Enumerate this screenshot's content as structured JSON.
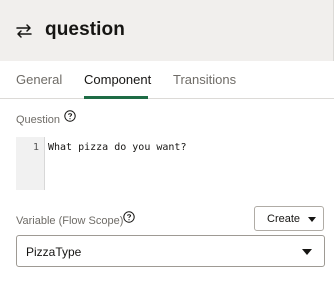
{
  "header": {
    "icon": "swap-arrows-icon",
    "title": "question"
  },
  "tabs": [
    {
      "label": "General",
      "active": false
    },
    {
      "label": "Component",
      "active": true
    },
    {
      "label": "Transitions",
      "active": false
    }
  ],
  "question": {
    "label": "Question",
    "help_icon": "question-circle-icon",
    "lines": [
      {
        "number": "1",
        "text": "What pizza do you want?"
      }
    ]
  },
  "variable": {
    "label": "Variable (Flow Scope)",
    "help_icon": "question-circle-icon",
    "create_label": "Create",
    "selected_value": "PizzaType"
  },
  "colors": {
    "header_bg": "#f1efed",
    "active_tab_underline": "#1e6c45",
    "text": "#161513",
    "muted_text": "#6f6c67"
  }
}
